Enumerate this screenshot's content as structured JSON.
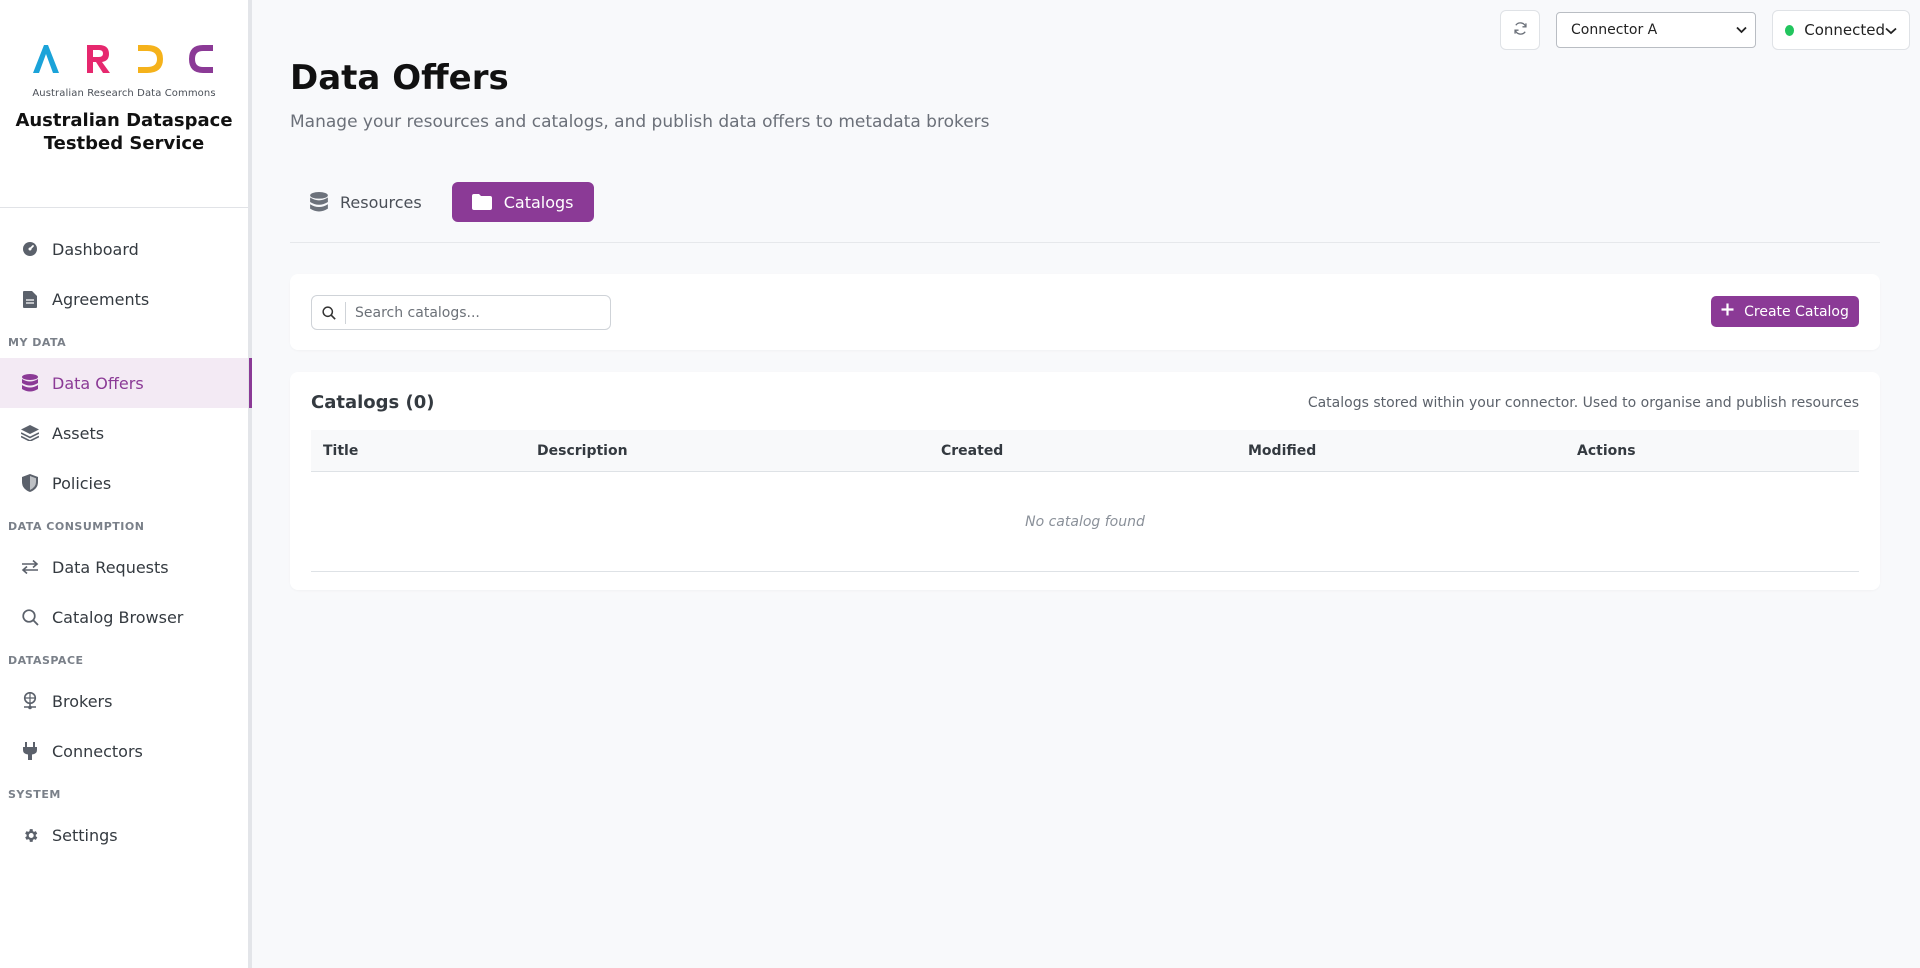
{
  "brand": {
    "logo_letters": [
      "A",
      "R",
      "D",
      "C"
    ],
    "logo_colors": [
      "#1ba3d9",
      "#e6286e",
      "#f5b21b",
      "#8b3a96"
    ],
    "logo_subtitle": "Australian Research Data Commons",
    "title_line1": "Australian Dataspace",
    "title_line2": "Testbed Service"
  },
  "sidebar": {
    "items_top": [
      {
        "label": "Dashboard",
        "icon": "gauge-icon"
      },
      {
        "label": "Agreements",
        "icon": "document-icon"
      }
    ],
    "section_my_data": "MY DATA",
    "items_my_data": [
      {
        "label": "Data Offers",
        "icon": "database-icon",
        "active": true
      },
      {
        "label": "Assets",
        "icon": "layers-icon"
      },
      {
        "label": "Policies",
        "icon": "shield-icon"
      }
    ],
    "section_consumption": "DATA CONSUMPTION",
    "items_consumption": [
      {
        "label": "Data Requests",
        "icon": "arrows-exchange-icon"
      },
      {
        "label": "Catalog Browser",
        "icon": "search-icon"
      }
    ],
    "section_dataspace": "DATASPACE",
    "items_dataspace": [
      {
        "label": "Brokers",
        "icon": "network-icon"
      },
      {
        "label": "Connectors",
        "icon": "plug-icon"
      }
    ],
    "section_system": "SYSTEM",
    "items_system": [
      {
        "label": "Settings",
        "icon": "gear-icon"
      }
    ]
  },
  "topbar": {
    "connector_selected": "Connector A",
    "status_label": "Connected",
    "status_color": "#22c55e"
  },
  "page": {
    "title": "Data Offers",
    "subtitle": "Manage your resources and catalogs, and publish data offers to metadata brokers"
  },
  "tabs": [
    {
      "label": "Resources",
      "icon": "database-icon",
      "active": false
    },
    {
      "label": "Catalogs",
      "icon": "folder-icon",
      "active": true
    }
  ],
  "toolbar": {
    "search_placeholder": "Search catalogs...",
    "create_label": "Create Catalog"
  },
  "table": {
    "title": "Catalogs (0)",
    "description": "Catalogs stored within your connector. Used to organise and publish resources",
    "columns": [
      "Title",
      "Description",
      "Created",
      "Modified",
      "Actions"
    ],
    "empty_text": "No catalog found"
  },
  "accent_color": "#8b3a96"
}
